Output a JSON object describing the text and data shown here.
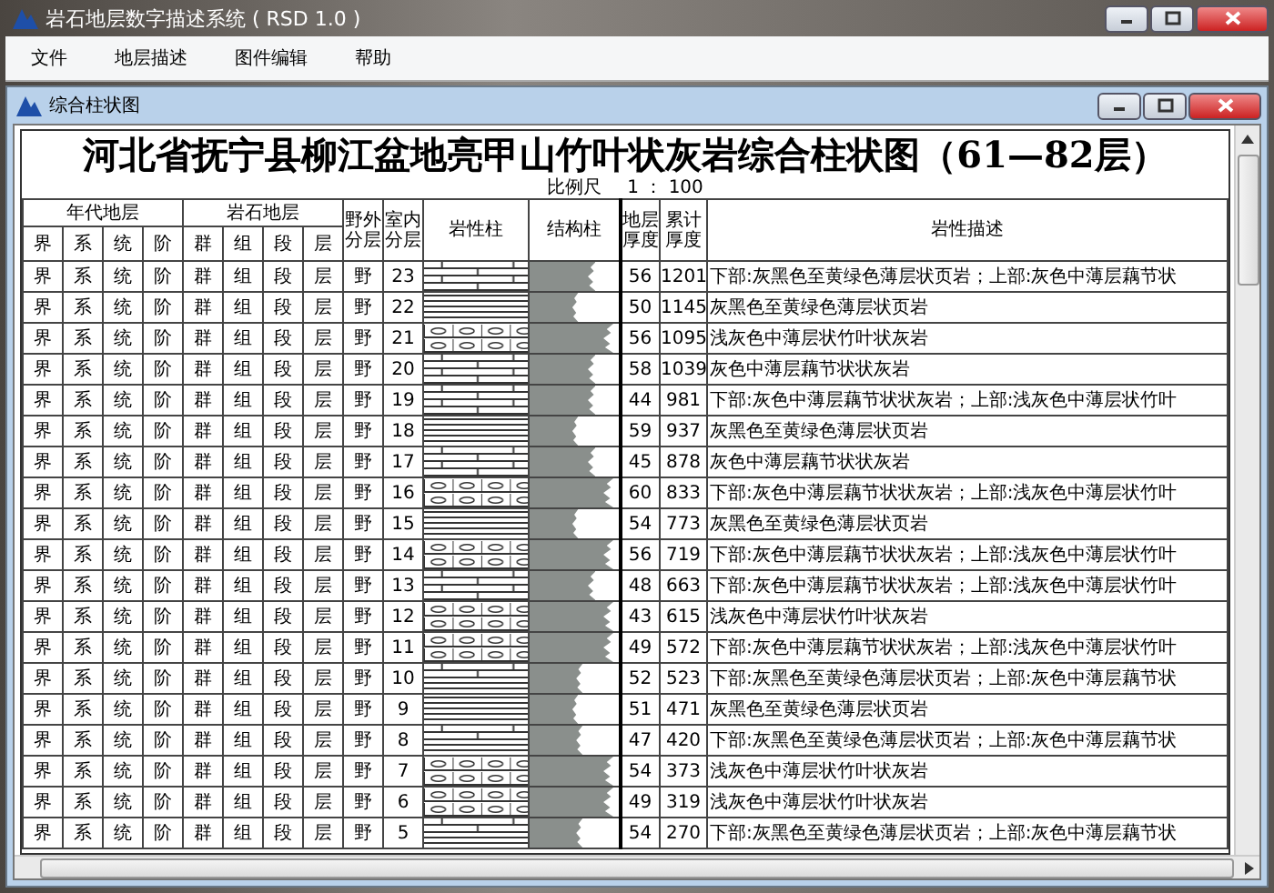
{
  "window": {
    "title": "岩石地层数字描述系统 ( RSD 1.0 )"
  },
  "menu": [
    "文件",
    "地层描述",
    "图件编辑",
    "帮助"
  ],
  "child_window": {
    "title": "综合柱状图"
  },
  "chart": {
    "title": "河北省抚宁县柳江盆地亮甲山竹叶状灰岩综合柱状图（61—82层）",
    "scale_label": "比例尺",
    "scale_value": "1 ： 100",
    "group_headers": [
      "年代地层",
      "岩石地层"
    ],
    "columns": [
      "界",
      "系",
      "统",
      "阶",
      "群",
      "组",
      "段",
      "层",
      "野外分层",
      "室内分层",
      "岩性柱",
      "结构柱",
      "地层厚度",
      "累计厚度",
      "岩性描述"
    ],
    "rows": [
      {
        "cells": [
          "界",
          "系",
          "统",
          "阶",
          "群",
          "组",
          "段",
          "层",
          "野"
        ],
        "layer": "23",
        "kind": "brick",
        "thickness": "56",
        "cumulative": "1201",
        "description": "下部:灰黑色至黄绿色薄层状页岩；上部:灰色中薄层藕节状"
      },
      {
        "cells": [
          "界",
          "系",
          "统",
          "阶",
          "群",
          "组",
          "段",
          "层",
          "野"
        ],
        "layer": "22",
        "kind": "lines",
        "thickness": "50",
        "cumulative": "1145",
        "description": "灰黑色至黄绿色薄层状页岩"
      },
      {
        "cells": [
          "界",
          "系",
          "统",
          "阶",
          "群",
          "组",
          "段",
          "层",
          "野"
        ],
        "layer": "21",
        "kind": "nodular",
        "thickness": "56",
        "cumulative": "1095",
        "description": "浅灰色中薄层状竹叶状灰岩"
      },
      {
        "cells": [
          "界",
          "系",
          "统",
          "阶",
          "群",
          "组",
          "段",
          "层",
          "野"
        ],
        "layer": "20",
        "kind": "brick",
        "thickness": "58",
        "cumulative": "1039",
        "description": "灰色中薄层藕节状状灰岩"
      },
      {
        "cells": [
          "界",
          "系",
          "统",
          "阶",
          "群",
          "组",
          "段",
          "层",
          "野"
        ],
        "layer": "19",
        "kind": "brick",
        "thickness": "44",
        "cumulative": "981",
        "description": "下部:灰色中薄层藕节状状灰岩；上部:浅灰色中薄层状竹叶"
      },
      {
        "cells": [
          "界",
          "系",
          "统",
          "阶",
          "群",
          "组",
          "段",
          "层",
          "野"
        ],
        "layer": "18",
        "kind": "lines",
        "thickness": "59",
        "cumulative": "937",
        "description": "灰黑色至黄绿色薄层状页岩"
      },
      {
        "cells": [
          "界",
          "系",
          "统",
          "阶",
          "群",
          "组",
          "段",
          "层",
          "野"
        ],
        "layer": "17",
        "kind": "brick",
        "thickness": "45",
        "cumulative": "878",
        "description": "灰色中薄层藕节状状灰岩"
      },
      {
        "cells": [
          "界",
          "系",
          "统",
          "阶",
          "群",
          "组",
          "段",
          "层",
          "野"
        ],
        "layer": "16",
        "kind": "nodular",
        "thickness": "60",
        "cumulative": "833",
        "description": "下部:灰色中薄层藕节状状灰岩；上部:浅灰色中薄层状竹叶"
      },
      {
        "cells": [
          "界",
          "系",
          "统",
          "阶",
          "群",
          "组",
          "段",
          "层",
          "野"
        ],
        "layer": "15",
        "kind": "lines",
        "thickness": "54",
        "cumulative": "773",
        "description": "灰黑色至黄绿色薄层状页岩"
      },
      {
        "cells": [
          "界",
          "系",
          "统",
          "阶",
          "群",
          "组",
          "段",
          "层",
          "野"
        ],
        "layer": "14",
        "kind": "nodular",
        "thickness": "56",
        "cumulative": "719",
        "description": "下部:灰色中薄层藕节状状灰岩；上部:浅灰色中薄层状竹叶"
      },
      {
        "cells": [
          "界",
          "系",
          "统",
          "阶",
          "群",
          "组",
          "段",
          "层",
          "野"
        ],
        "layer": "13",
        "kind": "brick",
        "thickness": "48",
        "cumulative": "663",
        "description": "下部:灰色中薄层藕节状状灰岩；上部:浅灰色中薄层状竹叶"
      },
      {
        "cells": [
          "界",
          "系",
          "统",
          "阶",
          "群",
          "组",
          "段",
          "层",
          "野"
        ],
        "layer": "12",
        "kind": "nodular",
        "thickness": "43",
        "cumulative": "615",
        "description": "浅灰色中薄层状竹叶状灰岩"
      },
      {
        "cells": [
          "界",
          "系",
          "统",
          "阶",
          "群",
          "组",
          "段",
          "层",
          "野"
        ],
        "layer": "11",
        "kind": "nodular",
        "thickness": "49",
        "cumulative": "572",
        "description": "下部:灰色中薄层藕节状状灰岩；上部:浅灰色中薄层状竹叶"
      },
      {
        "cells": [
          "界",
          "系",
          "统",
          "阶",
          "群",
          "组",
          "段",
          "层",
          "野"
        ],
        "layer": "10",
        "kind": "mixed",
        "thickness": "52",
        "cumulative": "523",
        "description": "下部:灰黑色至黄绿色薄层状页岩；上部:灰色中薄层藕节状"
      },
      {
        "cells": [
          "界",
          "系",
          "统",
          "阶",
          "群",
          "组",
          "段",
          "层",
          "野"
        ],
        "layer": "9",
        "kind": "lines",
        "thickness": "51",
        "cumulative": "471",
        "description": "灰黑色至黄绿色薄层状页岩"
      },
      {
        "cells": [
          "界",
          "系",
          "统",
          "阶",
          "群",
          "组",
          "段",
          "层",
          "野"
        ],
        "layer": "8",
        "kind": "mixed",
        "thickness": "47",
        "cumulative": "420",
        "description": "下部:灰黑色至黄绿色薄层状页岩；上部:灰色中薄层藕节状"
      },
      {
        "cells": [
          "界",
          "系",
          "统",
          "阶",
          "群",
          "组",
          "段",
          "层",
          "野"
        ],
        "layer": "7",
        "kind": "nodular",
        "thickness": "54",
        "cumulative": "373",
        "description": "浅灰色中薄层状竹叶状灰岩"
      },
      {
        "cells": [
          "界",
          "系",
          "统",
          "阶",
          "群",
          "组",
          "段",
          "层",
          "野"
        ],
        "layer": "6",
        "kind": "nodular",
        "thickness": "49",
        "cumulative": "319",
        "description": "浅灰色中薄层状竹叶状灰岩"
      },
      {
        "cells": [
          "界",
          "系",
          "统",
          "阶",
          "群",
          "组",
          "段",
          "层",
          "野"
        ],
        "layer": "5",
        "kind": "mixed",
        "thickness": "54",
        "cumulative": "270",
        "description": "下部:灰黑色至黄绿色薄层状页岩；上部:灰色中薄层藕节状"
      }
    ]
  }
}
